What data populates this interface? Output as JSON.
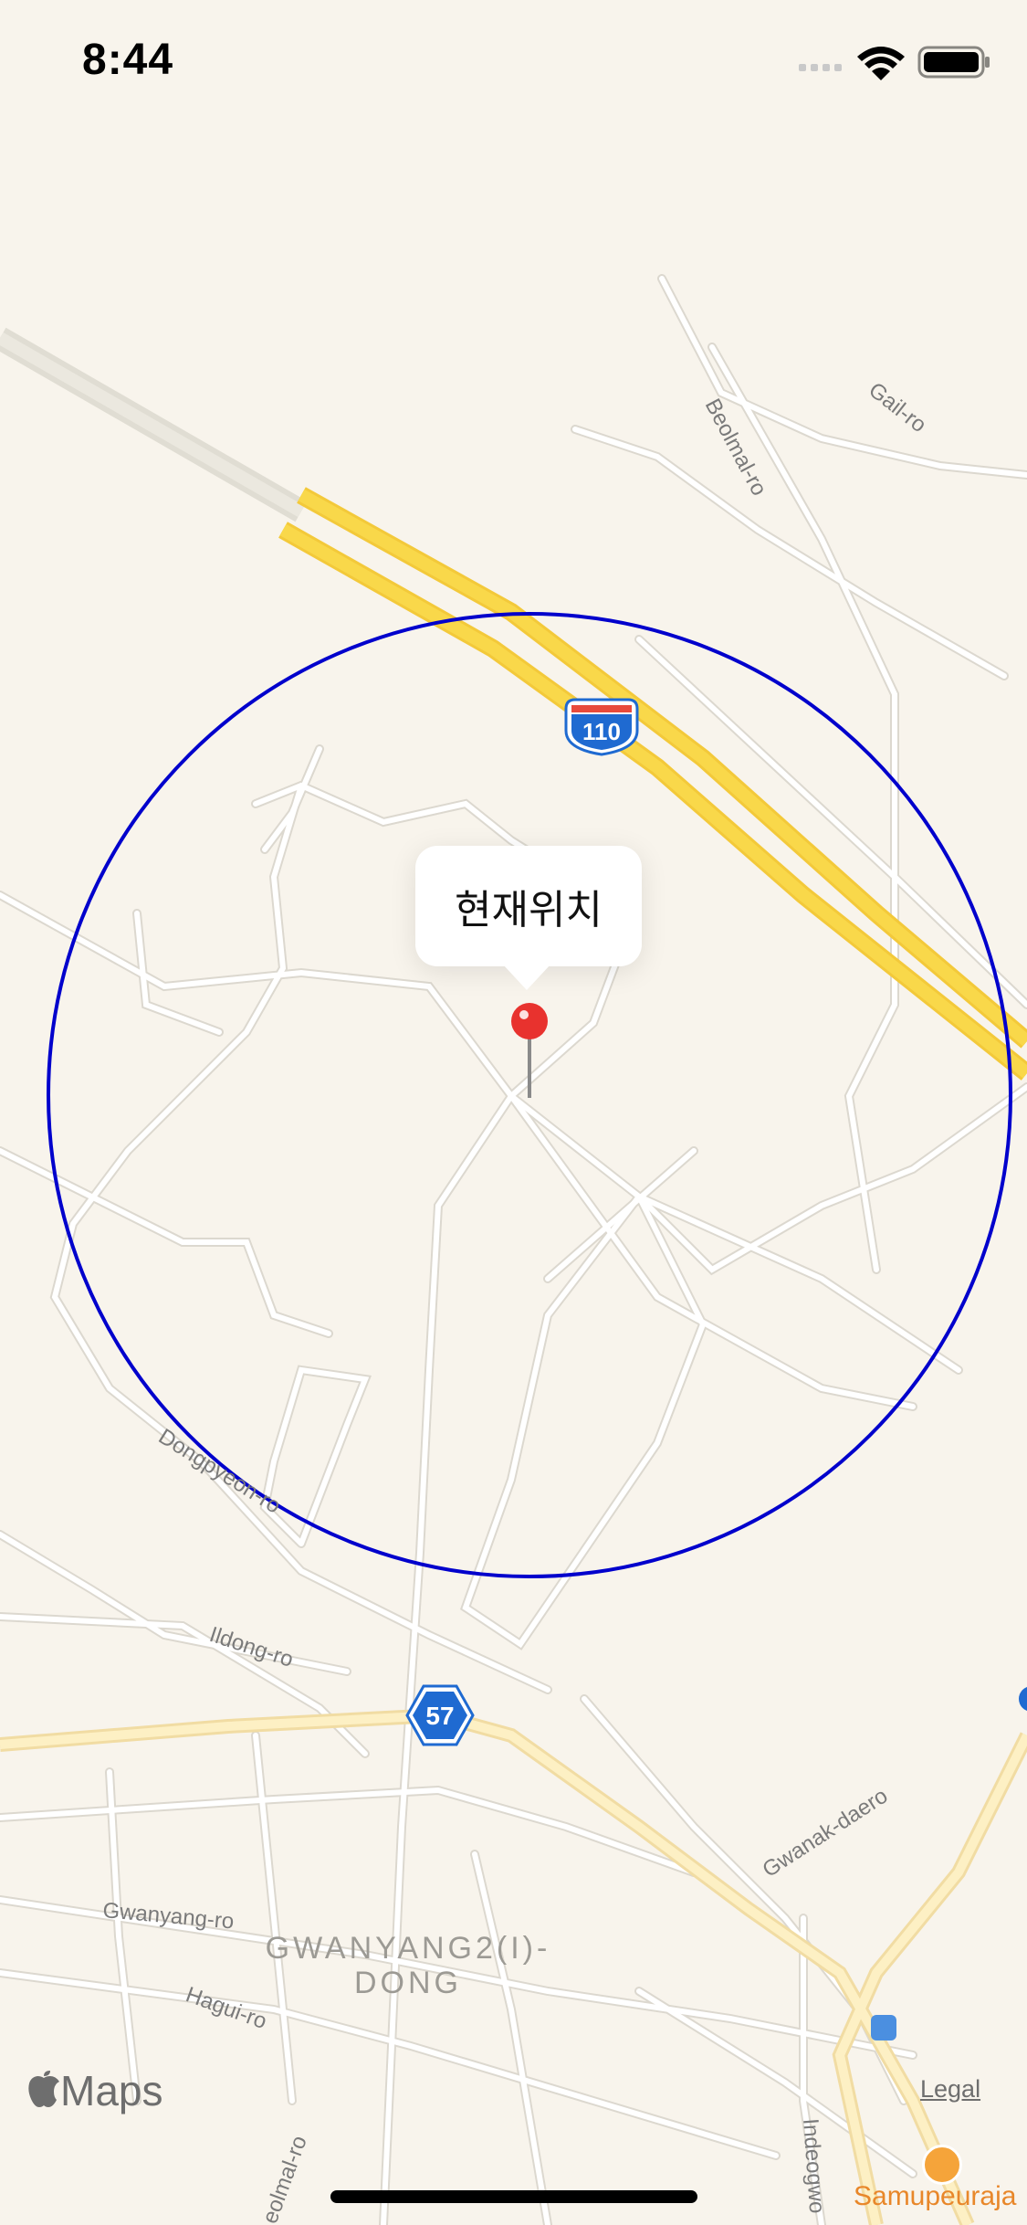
{
  "status_bar": {
    "time": "8:44"
  },
  "map": {
    "pin_callout": "현재위치",
    "circle_color": "#0000cc",
    "pin_color": "#e8322e",
    "highway_color": "#f9d84a",
    "road_labels": {
      "beolmal_ro": "Beolmal-ro",
      "gail_ro": "Gail-ro",
      "dongpyeon_ro": "Dongpyeon-ro",
      "ildong_ro": "Ildong-ro",
      "gwanyang_ro": "Gwanyang-ro",
      "hagui_ro": "Hagui-ro",
      "beolmal_ro_south": "eolmal-ro",
      "indeogwon": "Indeogwo",
      "gwanak_daero": "Gwanak-daero"
    },
    "district_line1": "GWANYANG2(I)-",
    "district_line2": "DONG",
    "shields": {
      "route_110": "110",
      "route_57": "57"
    },
    "poi": {
      "name": "Samupeuraja",
      "icon": "shop-icon"
    }
  },
  "footer": {
    "maps_brand": "Maps",
    "legal": "Legal"
  }
}
